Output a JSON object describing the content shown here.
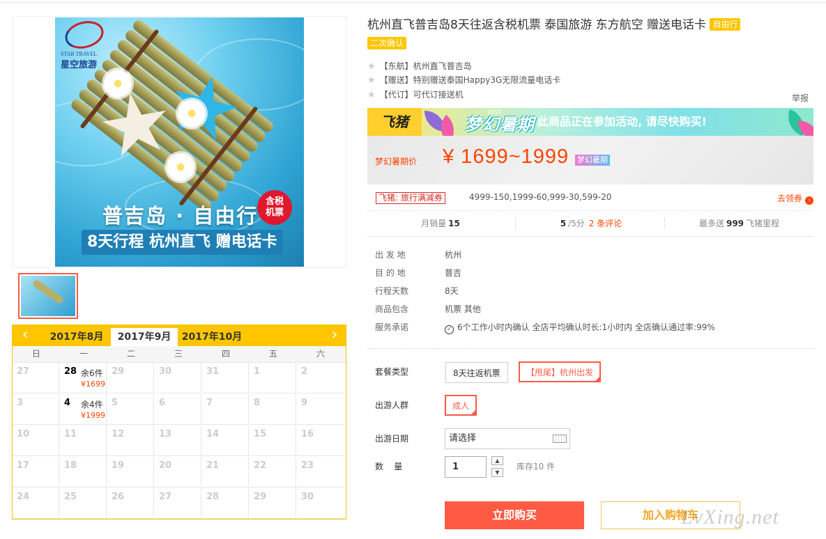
{
  "product": {
    "title": "杭州直飞普吉岛8天往返含税机票 泰国旅游 东方航空 赠送电话卡",
    "tags": [
      "自由行",
      "二次确认"
    ],
    "features": [
      "【东航】杭州直飞普吉岛",
      "【赠送】特别赠送泰国Happy3G无限流量电话卡",
      "【代订】可代订接送机"
    ],
    "report_label": "举报"
  },
  "hero": {
    "logo_en": "STAR TRAVEL",
    "logo_cn": "星空旅游",
    "title": "普吉岛 · 自由行",
    "subtitle": "8天行程  杭州直飞  赠电话卡",
    "badge_line1": "含税",
    "badge_line2": "机票"
  },
  "promo": {
    "brand": "飞猪",
    "campaign": "梦幻暑期",
    "campaign_year": "2017",
    "message": "此商品正在参加活动, 请尽快购买!"
  },
  "price": {
    "label": "梦幻暑期价",
    "value": "¥ 1699~1999",
    "badge": "梦幻暑期"
  },
  "coupon": {
    "tag": "飞猪: 旅行满减券",
    "rules": "4999-150,1999-60,999-30,599-20",
    "get_label": "去领券"
  },
  "stats": {
    "sales_label": "月销量",
    "sales_value": "15",
    "rating_value": "5",
    "rating_suffix": "/5分",
    "reviews": "2 条评论",
    "miles_prefix": "最多送",
    "miles_value": "999",
    "miles_suffix": "飞猪里程"
  },
  "attributes": [
    {
      "key": "出 发 地",
      "value": "杭州"
    },
    {
      "key": "目 的 地",
      "value": "普吉"
    },
    {
      "key": "行程天数",
      "value": "8天"
    },
    {
      "key": "商品包含",
      "value": "机票  其他"
    },
    {
      "key": "服务承诺",
      "value": "6个工作小时内确认    全店平均确认时长:1小时内    全店确认通过率:99%"
    }
  ],
  "options": {
    "package_label": "套餐类型",
    "packages": [
      "8天往返机票",
      "【甩尾】杭州出发"
    ],
    "people_label": "出游人群",
    "people": [
      "成人"
    ],
    "date_label": "出游日期",
    "date_placeholder": "请选择",
    "qty_label": "数    量",
    "qty_value": "1",
    "stock": "库存10 件"
  },
  "actions": {
    "buy": "立即购买",
    "cart": "加入购物车"
  },
  "calendar": {
    "months": [
      "2017年8月",
      "2017年9月",
      "2017年10月"
    ],
    "active_month": 1,
    "weekdays": [
      "日",
      "一",
      "二",
      "三",
      "四",
      "五",
      "六"
    ],
    "prev_arrow": "‹",
    "next_arrow": "›",
    "weeks": [
      [
        {
          "d": "27"
        },
        {
          "d": "28",
          "stock": "余6件",
          "price": "¥1699"
        },
        {
          "d": "29"
        },
        {
          "d": "30"
        },
        {
          "d": "31"
        },
        {
          "d": "1"
        },
        {
          "d": "2"
        }
      ],
      [
        {
          "d": "3"
        },
        {
          "d": "4",
          "stock": "余4件",
          "price": "¥1999"
        },
        {
          "d": "5"
        },
        {
          "d": "6"
        },
        {
          "d": "7"
        },
        {
          "d": "8"
        },
        {
          "d": "9"
        }
      ],
      [
        {
          "d": "10"
        },
        {
          "d": "11"
        },
        {
          "d": "12"
        },
        {
          "d": "13"
        },
        {
          "d": "14"
        },
        {
          "d": "15"
        },
        {
          "d": "16"
        }
      ],
      [
        {
          "d": "17"
        },
        {
          "d": "18"
        },
        {
          "d": "19"
        },
        {
          "d": "20"
        },
        {
          "d": "21"
        },
        {
          "d": "22"
        },
        {
          "d": "23"
        }
      ],
      [
        {
          "d": "24"
        },
        {
          "d": "25"
        },
        {
          "d": "26"
        },
        {
          "d": "27"
        },
        {
          "d": "28"
        },
        {
          "d": "29"
        },
        {
          "d": "30"
        }
      ]
    ]
  },
  "watermark": "LvXing.net",
  "colors": {
    "accent": "#ff5a43",
    "price": "#ff4400",
    "calendar": "#ffc600"
  }
}
